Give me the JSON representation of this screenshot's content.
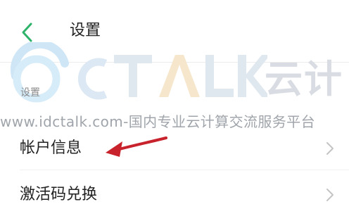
{
  "header": {
    "title": "设置",
    "back_icon": "chevron-left-icon",
    "back_color": "#2fb36b"
  },
  "watermark": {
    "brand": "云计",
    "url": "www.idctalk.com-国内专业云计算交流服务平台"
  },
  "section": {
    "label": "设置"
  },
  "items": [
    {
      "label": "帐户信息",
      "icon": "chevron-right-icon"
    },
    {
      "label": "激活码兑换",
      "icon": "chevron-right-icon"
    }
  ],
  "annotation": {
    "icon": "red-arrow-icon",
    "color": "#c8232c"
  }
}
